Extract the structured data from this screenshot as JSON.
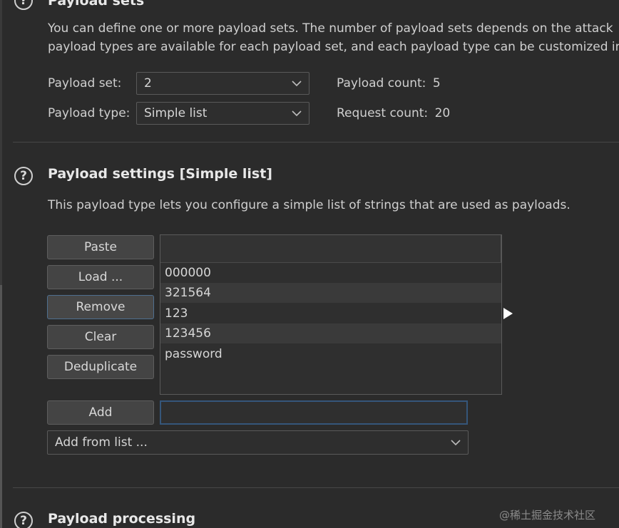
{
  "payload_sets": {
    "title": "Payload sets",
    "desc_line1": "You can define one or more payload sets. The number of payload sets depends on the attack",
    "desc_line2": "payload types are available for each payload set, and each payload type can be customized in",
    "set_label": "Payload set:",
    "set_value": "2",
    "type_label": "Payload type:",
    "type_value": "Simple list",
    "payload_count_label": "Payload count:",
    "payload_count": "5",
    "request_count_label": "Request count:",
    "request_count": "20"
  },
  "payload_settings": {
    "title": "Payload settings [Simple list]",
    "desc": "This payload type lets you configure a simple list of strings that are used as payloads.",
    "buttons": {
      "paste": "Paste",
      "load": "Load ...",
      "remove": "Remove",
      "clear": "Clear",
      "deduplicate": "Deduplicate",
      "add": "Add"
    },
    "items": [
      "000000",
      "321564",
      "123",
      "123456",
      "password"
    ],
    "add_value": "",
    "add_from_list": "Add from list ..."
  },
  "payload_processing": {
    "title": "Payload processing"
  },
  "watermark": "@稀土掘金技术社区",
  "icons": {
    "help": "help-circle-icon",
    "dropdown": "chevron-down-icon",
    "pointer": "cursor-arrow-icon"
  }
}
